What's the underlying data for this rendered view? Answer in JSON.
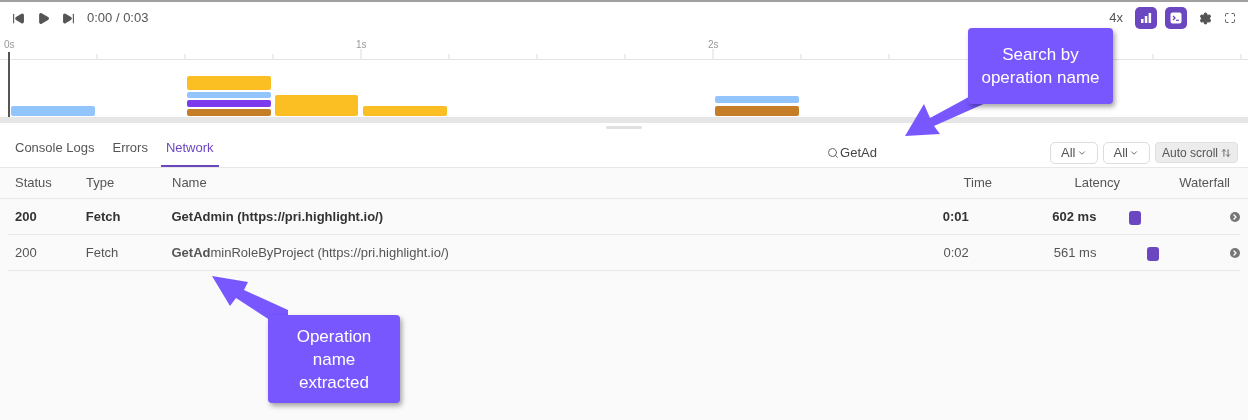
{
  "player": {
    "time": "0:00 / 0:03",
    "speed": "4x",
    "toggles": [
      {
        "kind": "chart",
        "selected": true
      },
      {
        "kind": "console",
        "selected": true
      }
    ]
  },
  "timeline": {
    "ticks": [
      "0s",
      "1s",
      "2s"
    ]
  },
  "tabs": [
    {
      "label": "Console Logs",
      "selected": false
    },
    {
      "label": "Errors",
      "selected": false
    },
    {
      "label": "Network",
      "selected": true
    }
  ],
  "search": {
    "value": "GetAd"
  },
  "filters": [
    "All",
    "All"
  ],
  "auto_scroll": "Auto scroll",
  "table": {
    "columns": [
      "Status",
      "Type",
      "Name",
      "Time",
      "Latency",
      "Waterfall"
    ],
    "rows": [
      {
        "status": "200",
        "type": "Fetch",
        "name": "**GetAd**min (https://pri.highlight.io/)",
        "time": "0:01",
        "latency": "602 ms",
        "selected": true
      },
      {
        "status": "200",
        "type": "Fetch",
        "name": "**GetAd**minRoleByProject (https://pri.highlight.io/)",
        "time": "0:02",
        "latency": "561 ms",
        "selected": false
      }
    ]
  },
  "callouts": [
    {
      "text": "Search by operation name"
    },
    {
      "text": "Operation name extracted"
    }
  ]
}
